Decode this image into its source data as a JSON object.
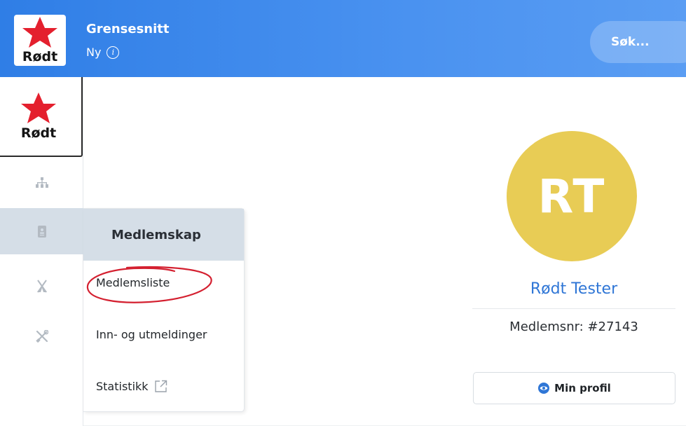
{
  "header": {
    "logo_text": "Rødt",
    "app_title": "Grensesnitt",
    "app_subtitle": "Ny",
    "info_icon": "i",
    "search_placeholder": "Søk..."
  },
  "sidebar": {
    "logo_text": "Rødt",
    "items": [
      {
        "icon": "org-chart-icon",
        "active": false
      },
      {
        "icon": "member-card-icon",
        "active": true
      },
      {
        "icon": "tent-icon",
        "active": false
      },
      {
        "icon": "tools-icon",
        "active": false
      }
    ]
  },
  "flyout": {
    "title": "Medlemskap",
    "items": [
      {
        "label": "Medlemsliste",
        "highlighted": true
      },
      {
        "label": "Inn- og utmeldinger"
      },
      {
        "label": "Statistikk",
        "external": true
      }
    ]
  },
  "profile": {
    "initials": "RT",
    "name": "Rødt Tester",
    "member_number": "Medlemsnr: #27143",
    "button_label": "Min profil"
  },
  "colors": {
    "header_blue": "#3a86ea",
    "avatar_yellow": "#e8cc55",
    "link_blue": "#2f76d6",
    "logo_red": "#e4202e",
    "annotation_red": "#d42030",
    "active_nav_bg": "#d5dee7"
  }
}
